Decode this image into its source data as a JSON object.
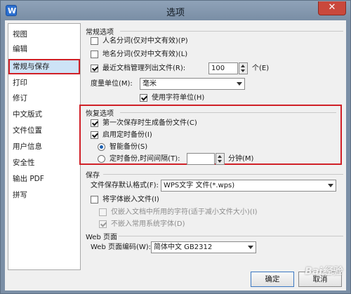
{
  "window": {
    "title": "选项",
    "close_glyph": "✕"
  },
  "sidebar": {
    "items": [
      {
        "label": "视图"
      },
      {
        "label": "编辑"
      },
      {
        "label": "常规与保存"
      },
      {
        "label": "打印"
      },
      {
        "label": "修订"
      },
      {
        "label": "中文版式"
      },
      {
        "label": "文件位置"
      },
      {
        "label": "用户信息"
      },
      {
        "label": "安全性"
      },
      {
        "label": "输出 PDF"
      },
      {
        "label": "拼写"
      }
    ],
    "selected": "常规与保存"
  },
  "general": {
    "title": "常规选项",
    "person_name": {
      "label": "人名分词(仅对中文有效)(P)",
      "checked": false
    },
    "place_name": {
      "label": "地名分词(仅对中文有效)(L)",
      "checked": false
    },
    "recent_docs": {
      "label": "最近文档管理列出文件(R):",
      "checked": true,
      "value": "100",
      "unit": "个(E)"
    },
    "measure": {
      "label": "度量单位(M):",
      "value": "毫米"
    },
    "char_unit": {
      "label": "使用字符单位(H)",
      "checked": true
    }
  },
  "recovery": {
    "title": "恢复选项",
    "first_backup": {
      "label": "第一次保存时生成备份文件(C)",
      "checked": true
    },
    "timed_backup": {
      "label": "启用定时备份(I)",
      "checked": true
    },
    "smart_backup": {
      "label": "智能备份(S)",
      "checked": true
    },
    "interval_backup": {
      "label": "定时备份,时间间隔(T):",
      "checked": false,
      "value": "",
      "unit": "分钟(M)"
    }
  },
  "save": {
    "title": "保存",
    "default_format": {
      "label": "文件保存默认格式(F):",
      "value": "WPS文字 文件(*.wps)"
    },
    "embed_fonts": {
      "label": "将字体嵌入文件(I)",
      "checked": false
    },
    "embed_used": {
      "label": "仅嵌入文档中所用的字符(适于减小文件大小)(I)",
      "checked": false
    },
    "no_common": {
      "label": "不嵌入常用系统字体(D)",
      "checked": true
    }
  },
  "web": {
    "title": "Web 页面",
    "encoding": {
      "label": "Web 页面编码(W):",
      "value": "简体中文 GB2312"
    }
  },
  "buttons": {
    "ok": "确定",
    "cancel": "取消"
  },
  "watermark": "Bai经验"
}
